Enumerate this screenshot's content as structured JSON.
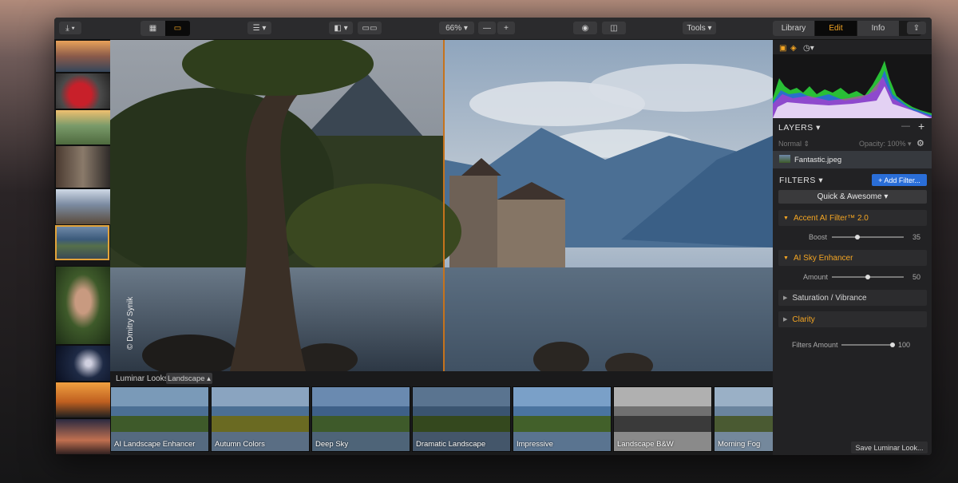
{
  "toolbar": {
    "zoom": "66%",
    "zoom_out": "—",
    "zoom_in": "+",
    "tools": "Tools",
    "tabs": [
      {
        "label": "Library",
        "active": false
      },
      {
        "label": "Edit",
        "active": true
      },
      {
        "label": "Info",
        "active": false
      }
    ]
  },
  "panel": {
    "layers_label": "LAYERS",
    "layers_minus": "—",
    "layers_plus": "+",
    "blend_mode": "Normal",
    "opacity": "Opacity: 100%",
    "layer_name": "Fantastic.jpeg",
    "filters_label": "FILTERS",
    "add_filter": "+ Add Filter...",
    "preset": "Quick & Awesome",
    "filters": [
      {
        "name": "Accent AI Filter™ 2.0",
        "param": "Boost",
        "value": "35",
        "level": 35,
        "expanded": true
      },
      {
        "name": "AI Sky Enhancer",
        "param": "Amount",
        "value": "50",
        "level": 50,
        "expanded": true
      },
      {
        "name": "Saturation / Vibrance",
        "expanded": false
      },
      {
        "name": "Clarity",
        "expanded": false
      }
    ],
    "filters_amount_label": "Filters Amount",
    "filters_amount_value": "100",
    "filters_amount_level": 100,
    "save_look": "Save Luminar Look..."
  },
  "looks": {
    "label": "Luminar Looks:",
    "category": "Landscape",
    "items": [
      {
        "name": "AI Landscape Enhancer"
      },
      {
        "name": "Autumn Colors"
      },
      {
        "name": "Deep Sky"
      },
      {
        "name": "Dramatic Landscape"
      },
      {
        "name": "Impressive"
      },
      {
        "name": "Landscape B&W"
      },
      {
        "name": "Morning Fog"
      }
    ]
  },
  "photo": {
    "watermark": "© Dmitry Synik"
  },
  "colors": {
    "accent": "#f5a623",
    "add_button": "#2a6ed8",
    "divider": "#c6731c"
  }
}
